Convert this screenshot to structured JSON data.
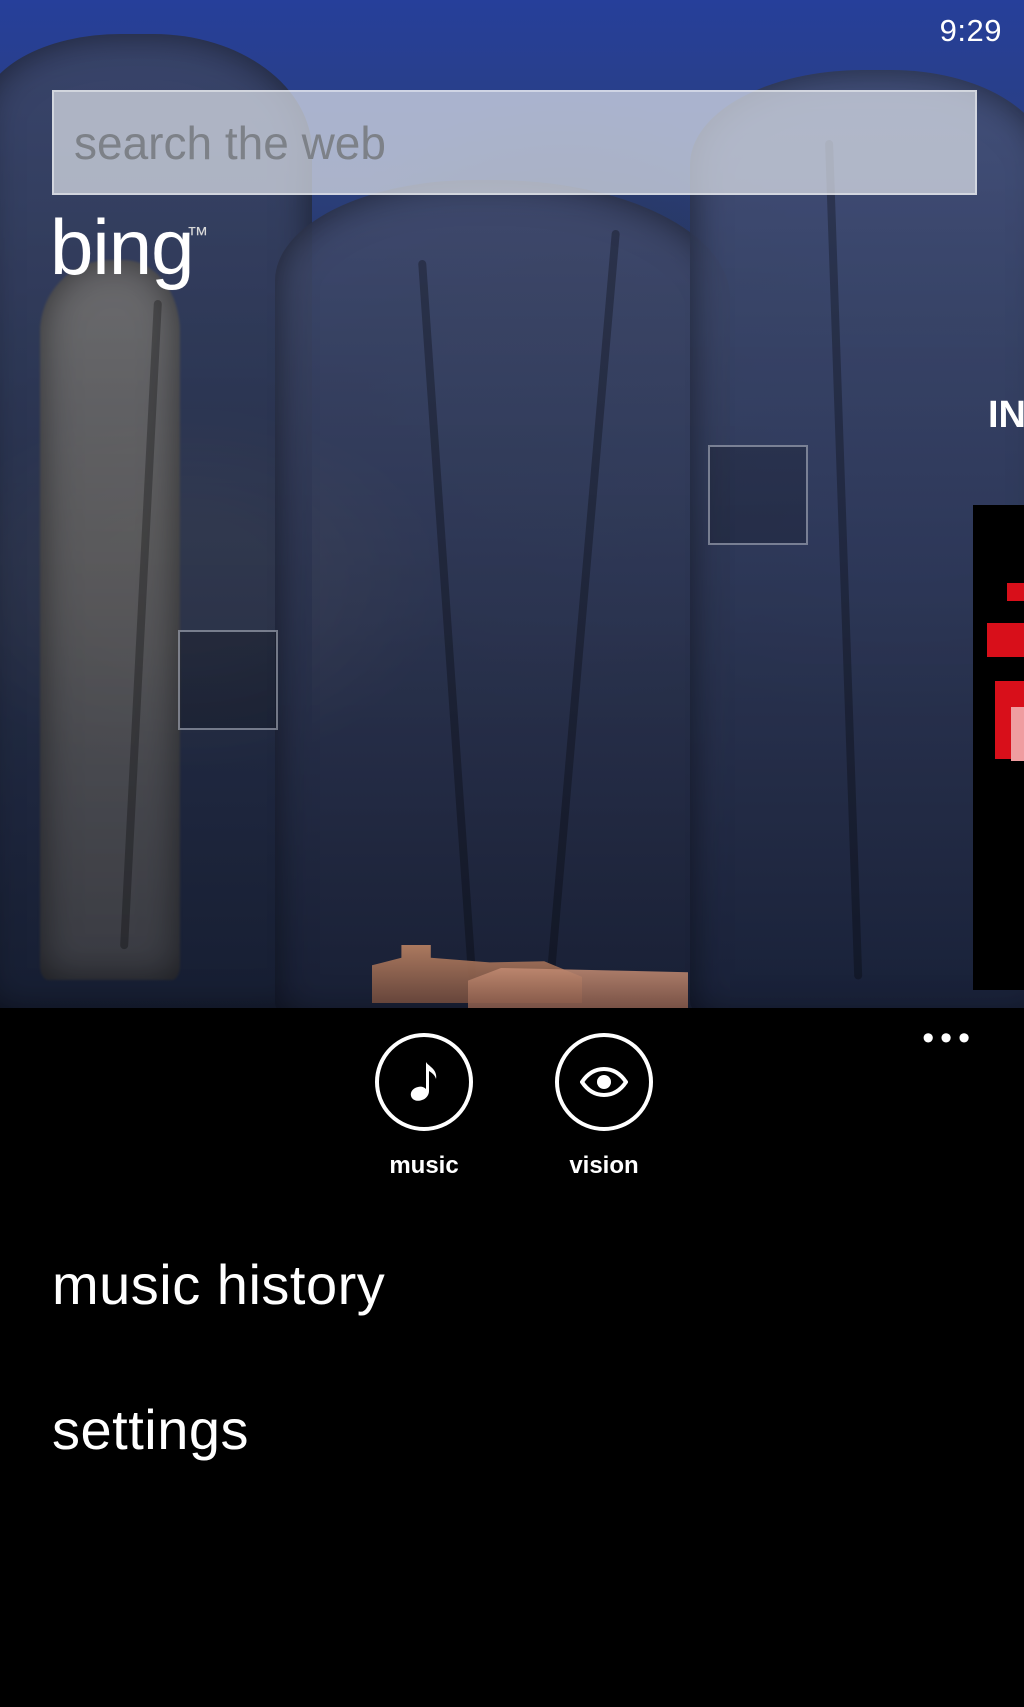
{
  "status_bar": {
    "time": "9:29"
  },
  "search": {
    "placeholder": "search the web"
  },
  "branding": {
    "logo_text": "bing"
  },
  "side_preview": {
    "label": "IN"
  },
  "app_actions": {
    "music": {
      "label": "music",
      "icon": "music-note-icon"
    },
    "vision": {
      "label": "vision",
      "icon": "eye-icon"
    },
    "more_icon": "ellipsis-icon"
  },
  "menu": {
    "items": [
      {
        "label": "music history"
      },
      {
        "label": "settings"
      }
    ]
  },
  "colors": {
    "background": "#000000",
    "text": "#ffffff",
    "search_box": "#dce1e9",
    "search_text": "#7d8188",
    "side_panel_accent": "#d80f1a"
  }
}
